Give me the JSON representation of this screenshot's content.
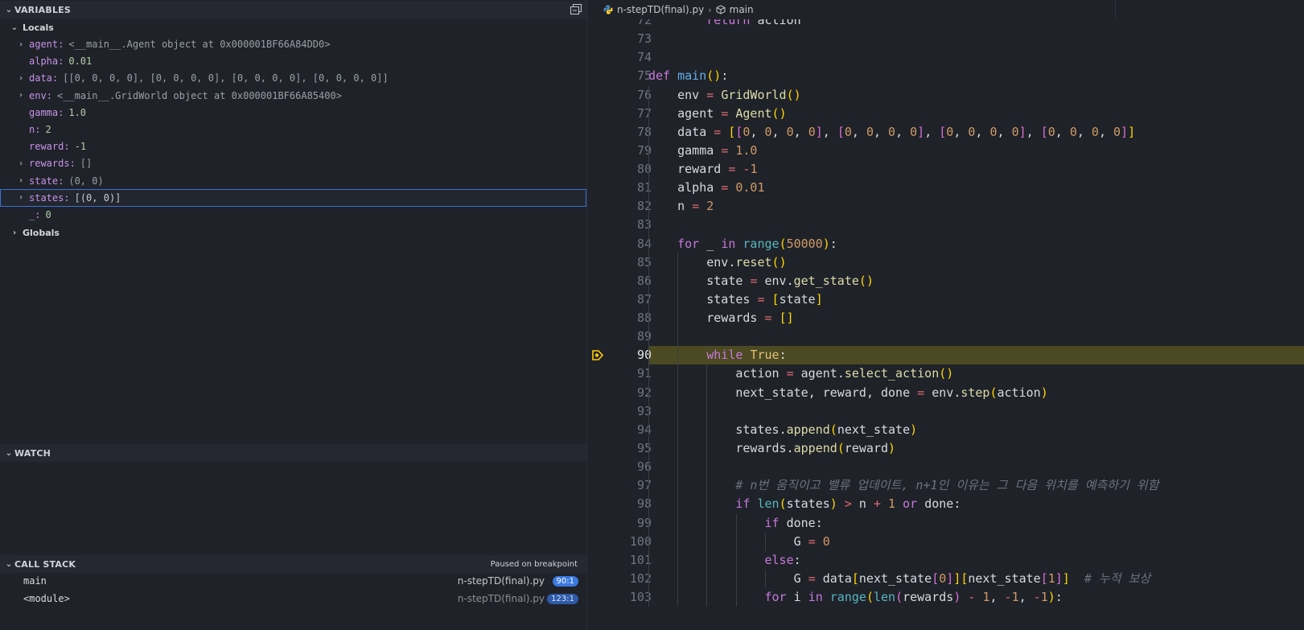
{
  "variables": {
    "header": "VARIABLES",
    "locals_label": "Locals",
    "globals_label": "Globals",
    "items": [
      {
        "name": "agent",
        "value": "<__main__.Agent object at 0x000001BF66A84DD0>",
        "kind": "obj",
        "expandable": true
      },
      {
        "name": "alpha",
        "value": "0.01",
        "kind": "num",
        "expandable": false
      },
      {
        "name": "data",
        "value": "[[0, 0, 0, 0], [0, 0, 0, 0], [0, 0, 0, 0], [0, 0, 0, 0]]",
        "kind": "obj",
        "expandable": true
      },
      {
        "name": "env",
        "value": "<__main__.GridWorld object at 0x000001BF66A85400>",
        "kind": "obj",
        "expandable": true
      },
      {
        "name": "gamma",
        "value": "1.0",
        "kind": "num",
        "expandable": false
      },
      {
        "name": "n",
        "value": "2",
        "kind": "num",
        "expandable": false
      },
      {
        "name": "reward",
        "value": "-1",
        "kind": "num",
        "expandable": false
      },
      {
        "name": "rewards",
        "value": "[]",
        "kind": "obj",
        "expandable": true
      },
      {
        "name": "state",
        "value": "(0, 0)",
        "kind": "obj",
        "expandable": true
      },
      {
        "name": "states",
        "value": "[(0, 0)]",
        "kind": "plain",
        "expandable": true,
        "selected": true
      },
      {
        "name": "_",
        "value": "0",
        "kind": "num",
        "expandable": false
      }
    ]
  },
  "watch": {
    "header": "WATCH"
  },
  "call_stack": {
    "header": "CALL STACK",
    "status": "Paused on breakpoint",
    "frames": [
      {
        "name": "main",
        "file": "n-stepTD(final).py",
        "pos": "90:1"
      },
      {
        "name": "<module>",
        "file": "n-stepTD(final).py",
        "pos": "123:1"
      }
    ]
  },
  "editor": {
    "breadcrumb": {
      "file": "n-stepTD(final).py",
      "symbol": "main"
    },
    "current_line": 90,
    "lines": [
      {
        "n": "72",
        "code": "        return action"
      },
      {
        "n": "73",
        "code": ""
      },
      {
        "n": "74",
        "code": ""
      },
      {
        "n": "75",
        "code": "def main():"
      },
      {
        "n": "76",
        "code": "    env = GridWorld()"
      },
      {
        "n": "77",
        "code": "    agent = Agent()"
      },
      {
        "n": "78",
        "code": "    data = [[0, 0, 0, 0], [0, 0, 0, 0], [0, 0, 0, 0], [0, 0, 0, 0]]"
      },
      {
        "n": "79",
        "code": "    gamma = 1.0"
      },
      {
        "n": "80",
        "code": "    reward = -1"
      },
      {
        "n": "81",
        "code": "    alpha = 0.01"
      },
      {
        "n": "82",
        "code": "    n = 2"
      },
      {
        "n": "83",
        "code": ""
      },
      {
        "n": "84",
        "code": "    for _ in range(50000):"
      },
      {
        "n": "85",
        "code": "        env.reset()"
      },
      {
        "n": "86",
        "code": "        state = env.get_state()"
      },
      {
        "n": "87",
        "code": "        states = [state]"
      },
      {
        "n": "88",
        "code": "        rewards = []"
      },
      {
        "n": "89",
        "code": ""
      },
      {
        "n": "90",
        "code": "        while True:"
      },
      {
        "n": "91",
        "code": "            action = agent.select_action()"
      },
      {
        "n": "92",
        "code": "            next_state, reward, done = env.step(action)"
      },
      {
        "n": "93",
        "code": ""
      },
      {
        "n": "94",
        "code": "            states.append(next_state)"
      },
      {
        "n": "95",
        "code": "            rewards.append(reward)"
      },
      {
        "n": "96",
        "code": ""
      },
      {
        "n": "97",
        "code": "            # n번 움직이고 밸류 업데이트, n+1인 이유는 그 다음 위치를 예측하기 위함"
      },
      {
        "n": "98",
        "code": "            if len(states) > n + 1 or done:"
      },
      {
        "n": "99",
        "code": "                if done:"
      },
      {
        "n": "100",
        "code": "                    G = 0"
      },
      {
        "n": "101",
        "code": "                else:"
      },
      {
        "n": "102",
        "code": "                    G = data[next_state[0]][next_state[1]]  # 누적 보상"
      },
      {
        "n": "103",
        "code": "                for i in range(len(rewards) - 1, -1, -1):"
      }
    ]
  },
  "colors": {
    "accent": "#3b79e0",
    "current_line_bg": "#4b4a22",
    "breakpoint": "#ffcc00"
  }
}
